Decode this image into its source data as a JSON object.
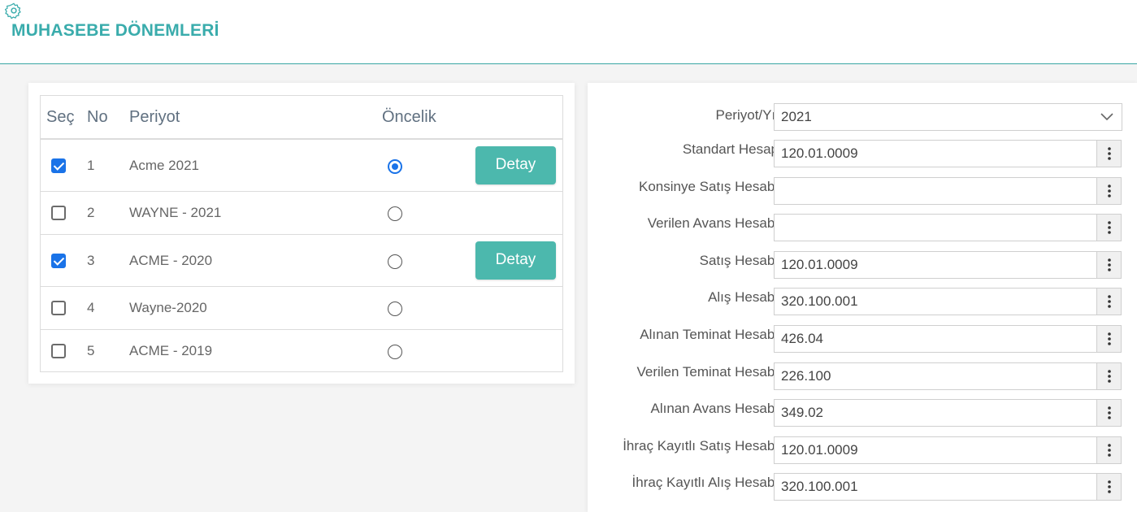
{
  "page": {
    "title": "MUHASEBE DÖNEMLERİ",
    "settings_icon": "gear-icon"
  },
  "colors": {
    "accent": "#3aacac",
    "button": "#4cb8ad",
    "check": "#1a73e8"
  },
  "periods_table": {
    "headers": {
      "select": "Seç",
      "no": "No",
      "period": "Periyot",
      "priority": "Öncelik"
    },
    "rows": [
      {
        "no": "1",
        "period": "Acme 2021",
        "selected": true,
        "priority": true,
        "detail_label": "Detay"
      },
      {
        "no": "2",
        "period": "WAYNE - 2021",
        "selected": false,
        "priority": false,
        "detail_label": ""
      },
      {
        "no": "3",
        "period": "ACME - 2020",
        "selected": true,
        "priority": false,
        "detail_label": "Detay"
      },
      {
        "no": "4",
        "period": "Wayne-2020",
        "selected": false,
        "priority": false,
        "detail_label": ""
      },
      {
        "no": "5",
        "period": "ACME - 2019",
        "selected": false,
        "priority": false,
        "detail_label": ""
      }
    ]
  },
  "form": {
    "period_year": {
      "label": "Periyot/Yıl",
      "value": "2021"
    },
    "fields": [
      {
        "label": "Standart Hesap",
        "value": "120.01.0009"
      },
      {
        "label": "Konsinye Satış Hesabı",
        "value": ""
      },
      {
        "label": "Verilen Avans Hesabı",
        "value": ""
      },
      {
        "label": "Satış Hesabı",
        "value": "120.01.0009"
      },
      {
        "label": "Alış Hesabı",
        "value": "320.100.001"
      },
      {
        "label": "Alınan Teminat Hesabı",
        "value": "426.04"
      },
      {
        "label": "Verilen Teminat Hesabı",
        "value": "226.100"
      },
      {
        "label": "Alınan Avans Hesabı",
        "value": "349.02"
      },
      {
        "label": "İhraç Kayıtlı Satış Hesabı",
        "value": "120.01.0009"
      },
      {
        "label": "İhraç Kayıtlı Alış Hesabı",
        "value": "320.100.001"
      }
    ],
    "lookup_icon": "kebab-menu-icon"
  }
}
